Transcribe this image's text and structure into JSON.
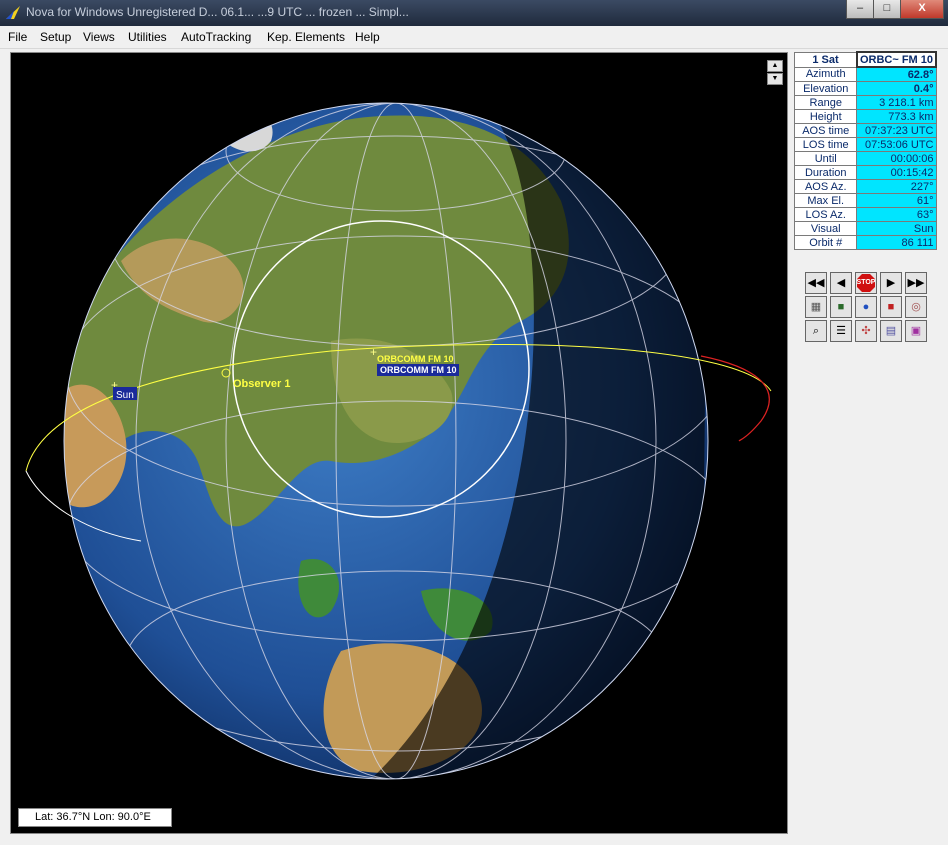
{
  "window": {
    "title": "Nova for Windows  Unregistered D...  06.1...  ...9 UTC  ...  frozen  ...  Simpl...",
    "minimize": "–",
    "maximize": "□",
    "close": "X"
  },
  "menu": [
    "File",
    "Setup",
    "Views",
    "Utilities",
    "AutoTracking",
    "Kep. Elements",
    "Help"
  ],
  "map": {
    "observer_label": "Observer 1",
    "sun_label": "Sun",
    "sat_label_1": "ORBCOMM FM 10",
    "sat_label_2": "ORBCOMM FM 10"
  },
  "status": {
    "text": "Lat: 36.7°N  Lon:  90.0°E"
  },
  "sat_info": {
    "header_key": "1 Sat",
    "header_value": "ORBC~ FM 10",
    "rows": [
      {
        "k": "Azimuth",
        "v": "62.8°"
      },
      {
        "k": "Elevation",
        "v": "0.4°"
      },
      {
        "k": "Range",
        "v": "3 218.1 km"
      },
      {
        "k": "Height",
        "v": "773.3 km"
      },
      {
        "k": "AOS time",
        "v": "07:37:23 UTC"
      },
      {
        "k": "LOS time",
        "v": "07:53:06 UTC"
      },
      {
        "k": "Until",
        "v": "00:00:06"
      },
      {
        "k": "Duration",
        "v": "00:15:42"
      },
      {
        "k": "AOS Az.",
        "v": "227°"
      },
      {
        "k": "Max El.",
        "v": "61°"
      },
      {
        "k": "LOS Az.",
        "v": "63°"
      },
      {
        "k": "Visual",
        "v": "Sun"
      },
      {
        "k": "Orbit #",
        "v": "86 111"
      }
    ]
  },
  "toolbar": {
    "rewind_icon": "double-left-arrow",
    "back_icon": "left-arrow",
    "stop_label": "STOP",
    "forward_icon": "right-arrow",
    "ffwd_icon": "double-right-arrow"
  },
  "colors": {
    "accent": "#00e5ff",
    "orbit": "#ffff44",
    "orbit_night": "#dd2222",
    "label_bg": "#1a2a9a"
  }
}
